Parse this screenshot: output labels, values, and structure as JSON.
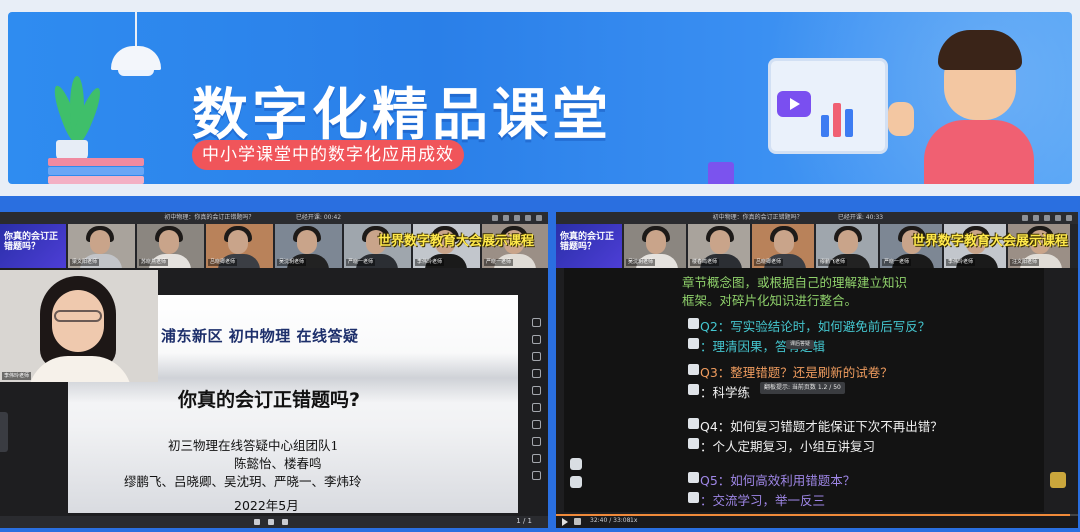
{
  "banner": {
    "title": "数字化精品课堂",
    "subtitle": "中小学课堂中的数字化应用成效"
  },
  "left_panel": {
    "topbar_title": "初中物理：你真的会订正错题吗？",
    "topbar_time": "已经开课: 00:42",
    "promo_text": "你真的会订正错题吗？",
    "overlay_title": "世界数字教育大会展示课程",
    "participants": [
      "梁文阳老师",
      "苏晓燕老师",
      "吕晓卿老师",
      "吴沈玥老师",
      "严晓一老师",
      "李伟玲老师",
      "严晓一老师"
    ],
    "main_cam_name": "李伟玲老师",
    "slide": {
      "subtitle": "浦东新区  初中物理  在线答疑",
      "question": "你真的会订正错题吗?",
      "team": "初三物理在线答疑中心组团队1",
      "members_line1": "陈懿怡、楼春鸣",
      "members_line2": "缪鹏飞、吕晓卿、吴沈玥、严晓一、李炜玲",
      "date": "2022年5月"
    },
    "page_indicator": "1 / 1"
  },
  "right_panel": {
    "topbar_title": "初中物理：你真的会订正错题吗？",
    "topbar_time": "已经开课: 40:33",
    "overlay_title": "世界数字教育大会展示课程",
    "participants": [
      "吴沈玥老师",
      "楼春鸣老师",
      "吕晓卿老师",
      "缪鹏飞老师",
      "严晓一老师",
      "李伟玲老师",
      "汪文阳老师"
    ],
    "notes": {
      "intro_line1": "章节概念图，或根据自己的理解建立知识",
      "intro_line2": "框架。对碎片化知识进行整合。",
      "q2": "Q2：写实验结论时，如何避免前后写反？",
      "a2": "：理清因果，答有逻辑",
      "q3": "Q3：整理错题？还是刷新的试卷？",
      "a3": "：科学练",
      "q4": "Q4：如何复习错题才能保证下次不再出错？",
      "a4": "：个人定期复习，小组互讲复习",
      "q5": "Q5：如何高效利用错题本？",
      "a5": "：交流学习，举一反三"
    },
    "tooltip_small": "课后答疑",
    "tooltip_page": "翻板提示: 当前页数 1.2 / 50",
    "playback_time": "32:40 / 33:08",
    "playback_speed": "1x",
    "playback_progress": 0.985
  }
}
